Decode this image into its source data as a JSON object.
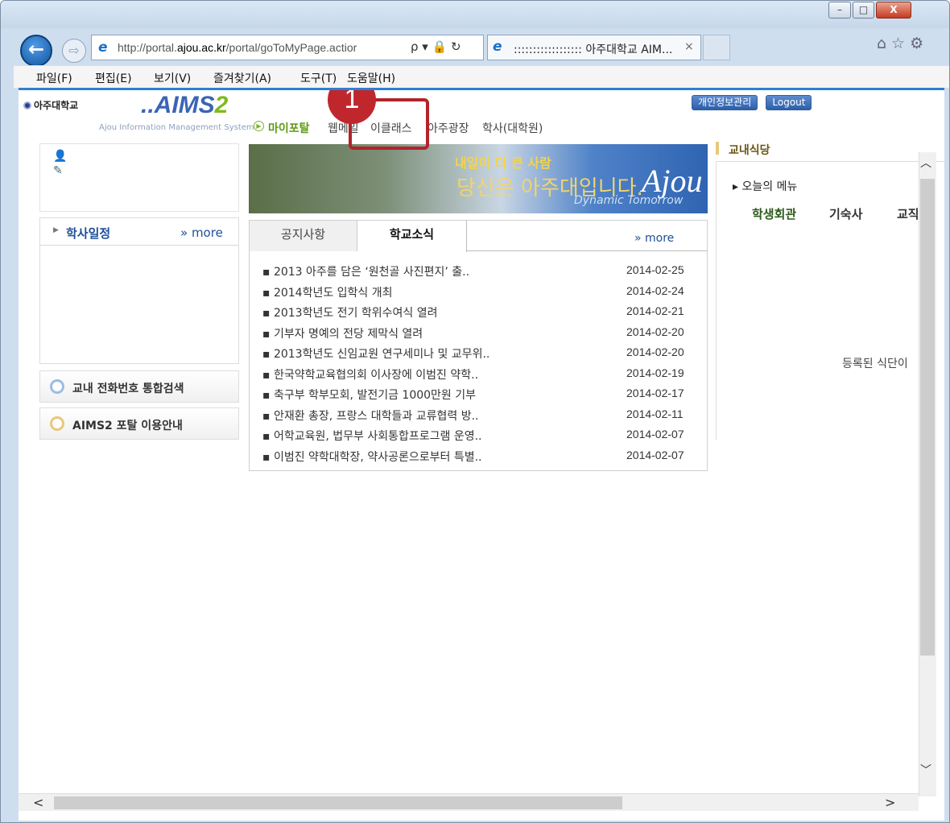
{
  "window": {
    "minimize": "–",
    "maximize": "□",
    "close": "X"
  },
  "nav": {
    "back_glyph": "←",
    "forward_glyph": "⇨",
    "url_prefix": "http://portal.",
    "url_domain": "ajou.ac.kr",
    "url_path": "/portal/goToMyPage.actior",
    "addr_icons": "ρ ▾ 🔒 ↻",
    "tab_title": ":::::::::::::::::: 아주대학교 AIM...",
    "tab_close": "×",
    "tools": "⌂☆⚙"
  },
  "menu": [
    "파일(F)",
    "편집(E)",
    "보기(V)",
    "즐겨찾기(A)",
    "도구(T)",
    "도움말(H)"
  ],
  "header": {
    "univ": "아주대학교",
    "aims_a": "..AIMS",
    "aims_b": "2",
    "aims_sub": "Ajou Information Management System",
    "links": [
      "개인정보관리",
      "Logout"
    ]
  },
  "gnb": [
    "마이포탈",
    "웹메일",
    "이클래스",
    "아주광장",
    "학사(대학원)"
  ],
  "annotation": {
    "badge": "1"
  },
  "user": {
    "icons": [
      "👤",
      "✎"
    ]
  },
  "calendar": {
    "title": "학사일정",
    "more": "» more"
  },
  "side_buttons": [
    "교내 전화번호 통합검색",
    "AIMS2 포탈 이용안내"
  ],
  "banner": {
    "line1": "내일이 더 큰 사람",
    "line2": "당신은 아주대입니다.",
    "dynamic": "Dynamic Tomorrow",
    "ajou": "Ajou"
  },
  "news": {
    "tabs": [
      "공지사항",
      "학교소식"
    ],
    "more": "» more",
    "rows": [
      {
        "title": "▪ 2013 아주를 담은 ‘원천골 사진편지’ 출..",
        "date": "2014-02-25"
      },
      {
        "title": "▪ 2014학년도 입학식 개최",
        "date": "2014-02-24"
      },
      {
        "title": "▪ 2013학년도 전기 학위수여식 열려",
        "date": "2014-02-21"
      },
      {
        "title": "▪ 기부자 명예의 전당 제막식 열려",
        "date": "2014-02-20"
      },
      {
        "title": "▪ 2013학년도 신임교원 연구세미나 및 교무위..",
        "date": "2014-02-20"
      },
      {
        "title": "▪ 한국약학교육협의회 이사장에 이범진 약학..",
        "date": "2014-02-19"
      },
      {
        "title": "▪ 축구부 학부모회, 발전기금 1000만원 기부",
        "date": "2014-02-17"
      },
      {
        "title": "▪ 안재환 총장, 프랑스 대학들과 교류협력 방..",
        "date": "2014-02-11"
      },
      {
        "title": "▪ 어학교육원, 법무부 사회통합프로그램 운영..",
        "date": "2014-02-07"
      },
      {
        "title": "▪ 이범진 약학대학장, 약사공론으로부터 특별..",
        "date": "2014-02-07"
      }
    ]
  },
  "cafeteria": {
    "title": "교내식당",
    "menu": "▸ 오늘의 메뉴",
    "tabs": [
      "학생회관",
      "기숙사",
      "교직"
    ],
    "empty": "등록된 식단이"
  },
  "scroll": {
    "up": "︿",
    "down": "﹀",
    "left": "<",
    "right": ">"
  }
}
